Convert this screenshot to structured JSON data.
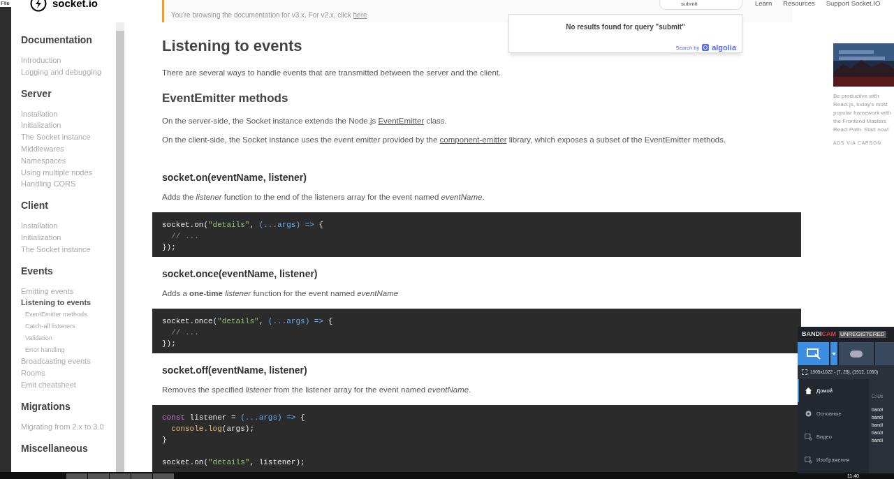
{
  "os_menu": {
    "label": "File"
  },
  "logo": {
    "text": "socket.io"
  },
  "search": {
    "value": "submit",
    "no_results": "No results found for query \"submit\"",
    "search_by": "Search by",
    "provider": "algolia"
  },
  "nav": [
    "Learn",
    "Resources",
    "Support Socket.IO"
  ],
  "notice": {
    "text": "You're browsing the documentation for v3.x. For v2.x, click ",
    "link": "here"
  },
  "sidebar": [
    {
      "heading": "Documentation",
      "items": [
        {
          "label": "Introduction",
          "selected": false
        },
        {
          "label": "Logging and debugging",
          "selected": false
        }
      ]
    },
    {
      "heading": "Server",
      "items": [
        {
          "label": "Installation",
          "selected": false
        },
        {
          "label": "Initialization",
          "selected": false
        },
        {
          "label": "The Socket instance",
          "selected": false
        },
        {
          "label": "Middlewares",
          "selected": false
        },
        {
          "label": "Namespaces",
          "selected": false
        },
        {
          "label": "Using multiple nodes",
          "selected": false
        },
        {
          "label": "Handling CORS",
          "selected": false
        }
      ]
    },
    {
      "heading": "Client",
      "items": [
        {
          "label": "Installation",
          "selected": false
        },
        {
          "label": "Initialization",
          "selected": false
        },
        {
          "label": "The Socket instance",
          "selected": false
        }
      ]
    },
    {
      "heading": "Events",
      "items": [
        {
          "label": "Emitting events",
          "selected": false
        },
        {
          "label": "Listening to events",
          "selected": true,
          "children": [
            {
              "label": "EventEmitter methods",
              "selected": false
            },
            {
              "label": "Catch-all listeners",
              "selected": false
            },
            {
              "label": "Validation",
              "selected": false
            },
            {
              "label": "Error handling",
              "selected": false
            }
          ]
        },
        {
          "label": "Broadcasting events",
          "selected": false
        },
        {
          "label": "Rooms",
          "selected": false
        },
        {
          "label": "Emit cheatsheet",
          "selected": false
        }
      ]
    },
    {
      "heading": "Migrations",
      "items": [
        {
          "label": "Migrating from 2.x to 3.0",
          "selected": false
        }
      ]
    },
    {
      "heading": "Miscellaneous"
    }
  ],
  "article": [
    {
      "kind": "h1",
      "text": "Listening to events"
    },
    {
      "kind": "p",
      "parts": [
        {
          "kind": "text",
          "text": "There are several ways to handle events that are transmitted between the server and the client."
        }
      ]
    },
    {
      "kind": "h2",
      "text": "EventEmitter methods"
    },
    {
      "kind": "p",
      "parts": [
        {
          "kind": "text",
          "text": "On the server-side, the Socket instance extends the Node.js "
        },
        {
          "kind": "link",
          "text": "EventEmitter"
        },
        {
          "kind": "text",
          "text": " class."
        }
      ]
    },
    {
      "kind": "p",
      "parts": [
        {
          "kind": "text",
          "text": "On the client-side, the Socket instance uses the event emitter provided by the "
        },
        {
          "kind": "link",
          "text": "component-emitter"
        },
        {
          "kind": "text",
          "text": " library, which exposes a subset of the EventEmitter methods."
        }
      ]
    },
    {
      "kind": "h3",
      "text": "socket.on(eventName, listener)"
    },
    {
      "kind": "p",
      "parts": [
        {
          "kind": "text",
          "text": "Adds the *listener* function to the end of the listeners array for the event named *eventName*."
        }
      ]
    },
    {
      "kind": "code",
      "groups": [
        [
          [
            {
              "kind": "plain",
              "s": "socket.on("
            },
            {
              "kind": "string",
              "s": "\"details\""
            },
            {
              "kind": "plain",
              "s": ", "
            },
            {
              "kind": "param",
              "s": "(...args) =>"
            },
            {
              "kind": "plain",
              "s": " {"
            }
          ],
          [
            {
              "kind": "comment",
              "s": "// ..."
            }
          ],
          [
            {
              "kind": "plain",
              "s": "});"
            }
          ]
        ]
      ]
    },
    {
      "kind": "h3",
      "text": "socket.once(eventName, listener)"
    },
    {
      "kind": "p",
      "parts": [
        {
          "kind": "text",
          "text": "Adds a **one-time** *listener* function for the event named *eventName*"
        }
      ]
    },
    {
      "kind": "code",
      "groups": [
        [
          [
            {
              "kind": "plain",
              "s": "socket.once("
            },
            {
              "kind": "string",
              "s": "\"details\""
            },
            {
              "kind": "plain",
              "s": ", "
            },
            {
              "kind": "param",
              "s": "(...args) =>"
            },
            {
              "kind": "plain",
              "s": " {"
            }
          ],
          [
            {
              "kind": "comment",
              "s": "// ..."
            }
          ],
          [
            {
              "kind": "plain",
              "s": "});"
            }
          ]
        ]
      ]
    },
    {
      "kind": "h3",
      "text": "socket.off(eventName, listener)"
    },
    {
      "kind": "p",
      "parts": [
        {
          "kind": "text",
          "text": "Removes the specified *listener* from the listener array for the event named *eventName*."
        }
      ]
    },
    {
      "kind": "code",
      "groups": [
        [
          [
            {
              "kind": "keyword",
              "s": "const"
            },
            {
              "kind": "plain",
              "s": " listener = "
            },
            {
              "kind": "param",
              "s": "(...args) =>"
            },
            {
              "kind": "plain",
              "s": " {"
            }
          ],
          [
            {
              "kind": "call",
              "s": "console.log"
            },
            {
              "kind": "plain",
              "s": "(args);"
            }
          ],
          [
            {
              "kind": "plain",
              "s": "}"
            }
          ]
        ],
        [
          [
            {
              "kind": "plain",
              "s": "socket.on("
            },
            {
              "kind": "string",
              "s": "\"details\""
            },
            {
              "kind": "plain",
              "s": ", listener);"
            }
          ]
        ]
      ]
    }
  ],
  "ad": {
    "kind": "picture",
    "description": "Be productive with React.js, today's most popular framework with the Frontend Masters React Path. Start now!",
    "footer": "ADS VIA CARBON"
  },
  "bandicam": {
    "brand_a": "BANDI",
    "brand_b": "CAM",
    "badge": "UNREGISTERED",
    "region_checked": false,
    "region": "1905x1022 - (7, 28), (1912, 1050)",
    "menu": [
      {
        "label": "Домой",
        "selected": true
      },
      {
        "label": "Основные",
        "selected": false
      },
      {
        "label": "Видео",
        "selected": false
      },
      {
        "label": "Изображения",
        "selected": false
      }
    ],
    "path": "C:\\Us",
    "files": [
      "bandi",
      "bandi",
      "bandi",
      "bandi",
      "bandi"
    ]
  },
  "taskbar": {
    "clock": "11:40"
  }
}
